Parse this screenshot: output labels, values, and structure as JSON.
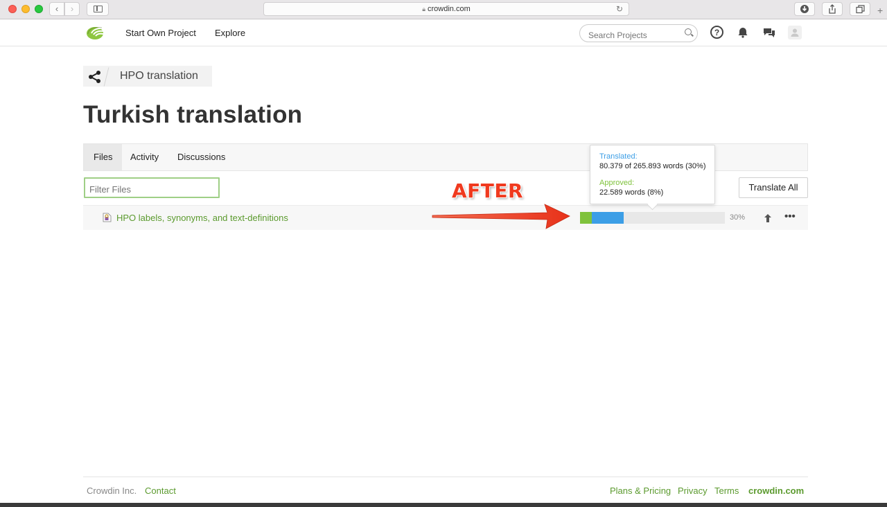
{
  "browser": {
    "url": "crowdin.com",
    "nav_back": "‹",
    "nav_forward": "›"
  },
  "header": {
    "nav": {
      "start_project": "Start Own Project",
      "explore": "Explore"
    },
    "search_placeholder": "Search Projects",
    "help_glyph": "?"
  },
  "breadcrumb": {
    "project": "HPO translation"
  },
  "page": {
    "title": "Turkish translation"
  },
  "tabs": [
    {
      "label": "Files",
      "active": true
    },
    {
      "label": "Activity",
      "active": false
    },
    {
      "label": "Discussions",
      "active": false
    }
  ],
  "files": {
    "filter_placeholder": "Filter Files",
    "translate_all": "Translate All",
    "rows": [
      {
        "name": "HPO labels, synonyms, and text-definitions",
        "translated_fraction": 0.3,
        "approved_fraction": 0.08,
        "percent_label": "30%",
        "more_glyph": "•••"
      }
    ]
  },
  "tooltip": {
    "translated_label": "Translated:",
    "translated_value": "80.379 of 265.893 words (30%)",
    "approved_label": "Approved:",
    "approved_value": "22.589 words (8%)"
  },
  "annotation": {
    "text": "AFTER"
  },
  "footer": {
    "company": "Crowdin Inc.",
    "contact": "Contact",
    "plans": "Plans & Pricing",
    "privacy": "Privacy",
    "terms": "Terms",
    "brand": "crowdin.com"
  },
  "colors": {
    "translated": "#3c9ee6",
    "approved": "#7fc23c",
    "link_green": "#5b9a2e",
    "annotation_red": "#f03a1f"
  }
}
